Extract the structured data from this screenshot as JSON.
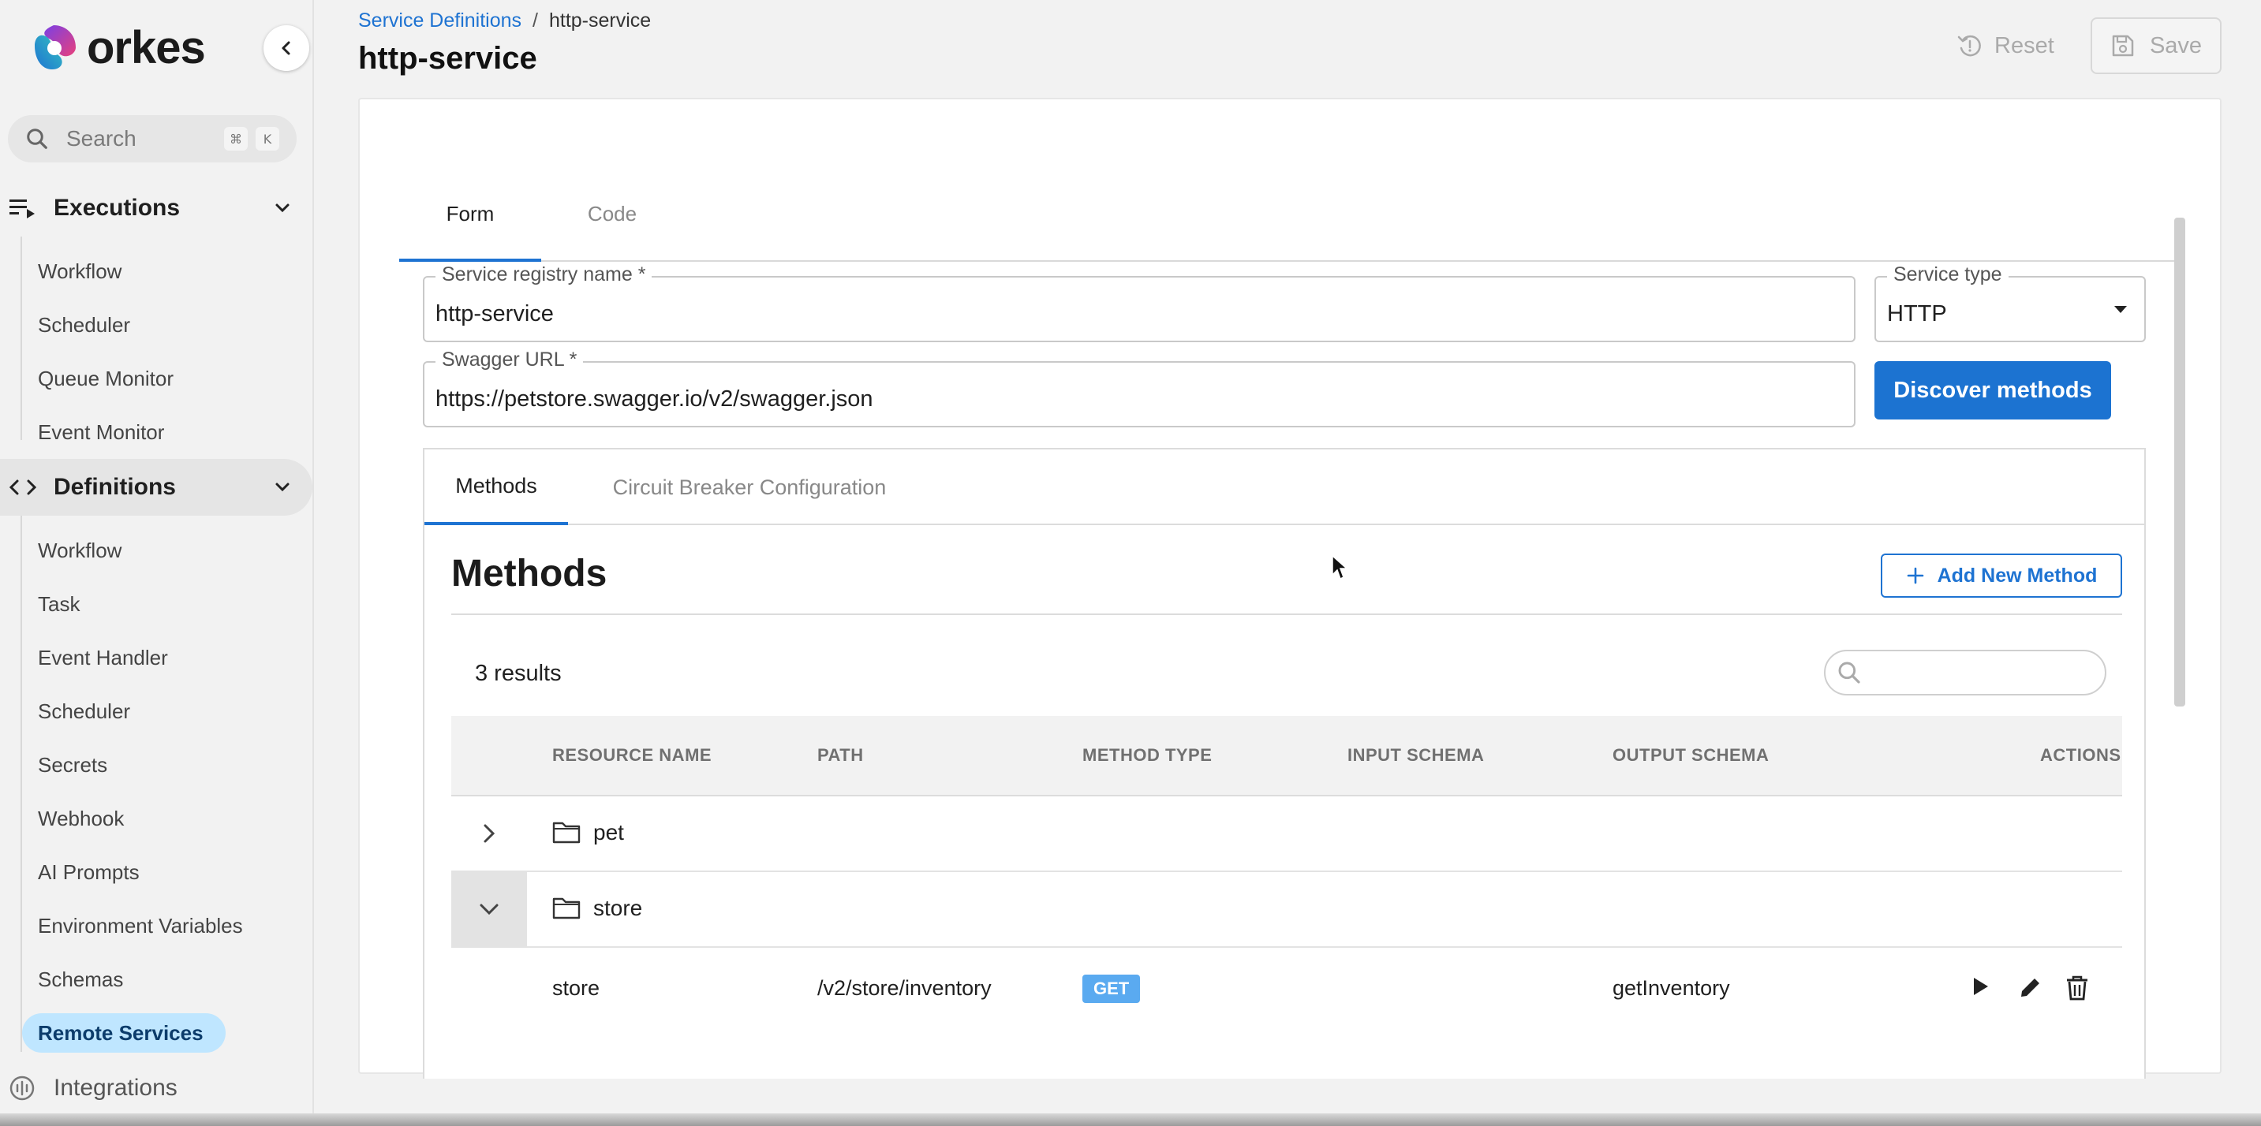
{
  "app": {
    "logo_text": "orkes",
    "search_placeholder": "Search",
    "search_shortcut": [
      "⌘",
      "K"
    ]
  },
  "sidebar": {
    "executions": {
      "label": "Executions",
      "items": [
        "Workflow",
        "Scheduler",
        "Queue Monitor",
        "Event Monitor"
      ]
    },
    "definitions": {
      "label": "Definitions",
      "items": [
        "Workflow",
        "Task",
        "Event Handler",
        "Scheduler",
        "Secrets",
        "Webhook",
        "AI Prompts",
        "Environment Variables",
        "Schemas",
        "Remote Services"
      ],
      "selected": "Remote Services"
    },
    "integrations": {
      "label": "Integrations"
    }
  },
  "header": {
    "breadcrumb": {
      "parent": "Service Definitions",
      "separator": "/",
      "current": "http-service"
    },
    "title": "http-service",
    "reset_label": "Reset",
    "save_label": "Save"
  },
  "form": {
    "tabs": {
      "form": "Form",
      "code": "Code"
    },
    "service_registry_name": {
      "label": "Service registry name *",
      "value": "http-service"
    },
    "service_type": {
      "label": "Service type",
      "value": "HTTP"
    },
    "swagger_url": {
      "label": "Swagger URL *",
      "value": "https://petstore.swagger.io/v2/swagger.json"
    },
    "discover_label": "Discover methods"
  },
  "methods": {
    "tabs": {
      "methods": "Methods",
      "circuit": "Circuit Breaker Configuration"
    },
    "title": "Methods",
    "add_label": "Add New Method",
    "results": "3 results",
    "columns": {
      "resource_name": "RESOURCE NAME",
      "path": "PATH",
      "method_type": "METHOD TYPE",
      "input_schema": "INPUT SCHEMA",
      "output_schema": "OUTPUT SCHEMA",
      "actions": "ACTIONS"
    },
    "groups": [
      {
        "name": "pet",
        "expanded": false
      },
      {
        "name": "store",
        "expanded": true
      }
    ],
    "rows": [
      {
        "resource_name": "store",
        "path": "/v2/store/inventory",
        "method_type": "GET",
        "input_schema": "",
        "output_schema": "getInventory"
      }
    ]
  },
  "colors": {
    "primary": "#1c73d1",
    "selected_nav_bg": "#bfe6ff",
    "get_badge": "#5aaaf0"
  }
}
